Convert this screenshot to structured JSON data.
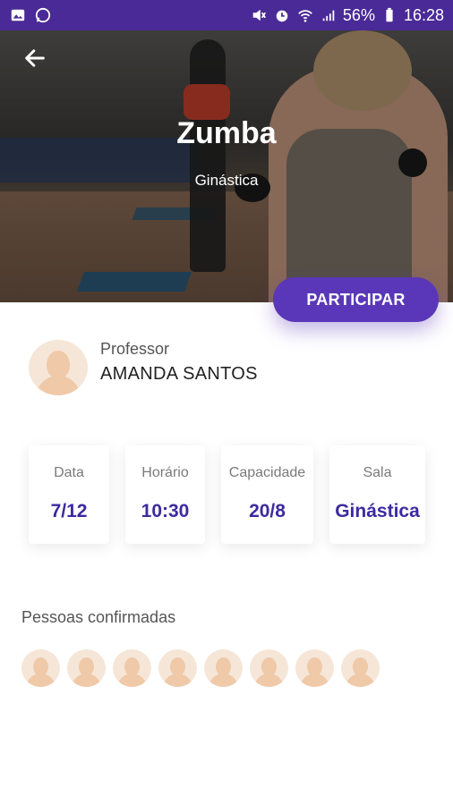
{
  "status_bar": {
    "battery": "56%",
    "time": "16:28"
  },
  "hero": {
    "title": "Zumba",
    "subtitle": "Ginástica",
    "join_label": "PARTICIPAR"
  },
  "teacher": {
    "role": "Professor",
    "name": "AMANDA SANTOS"
  },
  "info": [
    {
      "label": "Data",
      "value": "7/12"
    },
    {
      "label": "Horário",
      "value": "10:30"
    },
    {
      "label": "Capacidade",
      "value": "20/8"
    },
    {
      "label": "Sala",
      "value": "Ginástica"
    }
  ],
  "confirmed": {
    "title": "Pessoas confirmadas",
    "count": 8
  },
  "colors": {
    "primary": "#5a37b8",
    "status_bar": "#4a2a96",
    "value_text": "#3d2aa0"
  }
}
